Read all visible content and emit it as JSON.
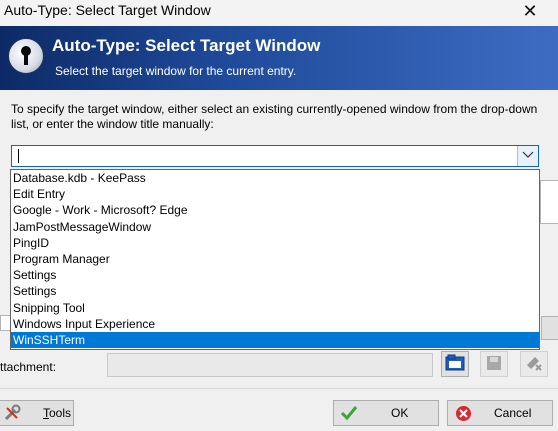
{
  "window": {
    "title": "Auto-Type: Select Target Window",
    "close_glyph": "✕"
  },
  "banner": {
    "title": "Auto-Type: Select Target Window",
    "subtitle": "Select the target window for the current entry.",
    "icon": "keyhole-icon"
  },
  "instructions": "To specify the target window, either select an existing currently-opened window from the drop-down list, or enter the window title manually:",
  "combo": {
    "value": "",
    "dropdown_glyph": "⌄",
    "items": [
      "Database.kdb - KeePass",
      "Edit Entry",
      "Google - Work - Microsoft? Edge",
      "JamPostMessageWindow",
      "PingID",
      "Program Manager",
      "Settings",
      "Settings",
      "Snipping Tool",
      "Windows Input Experience",
      "WinSSHTerm"
    ],
    "selected_index": 10
  },
  "attachment": {
    "label": "ttachment:",
    "value": ""
  },
  "buttons": {
    "tools": "Tools",
    "tools_mnemonic": "T",
    "tools_rest": "ools",
    "ok": "OK",
    "cancel": "Cancel"
  },
  "colors": {
    "banner_dark": "#0d2a66",
    "banner_light": "#3d6cc2",
    "selection": "#0078d7",
    "focus_border": "#0a64c9"
  }
}
